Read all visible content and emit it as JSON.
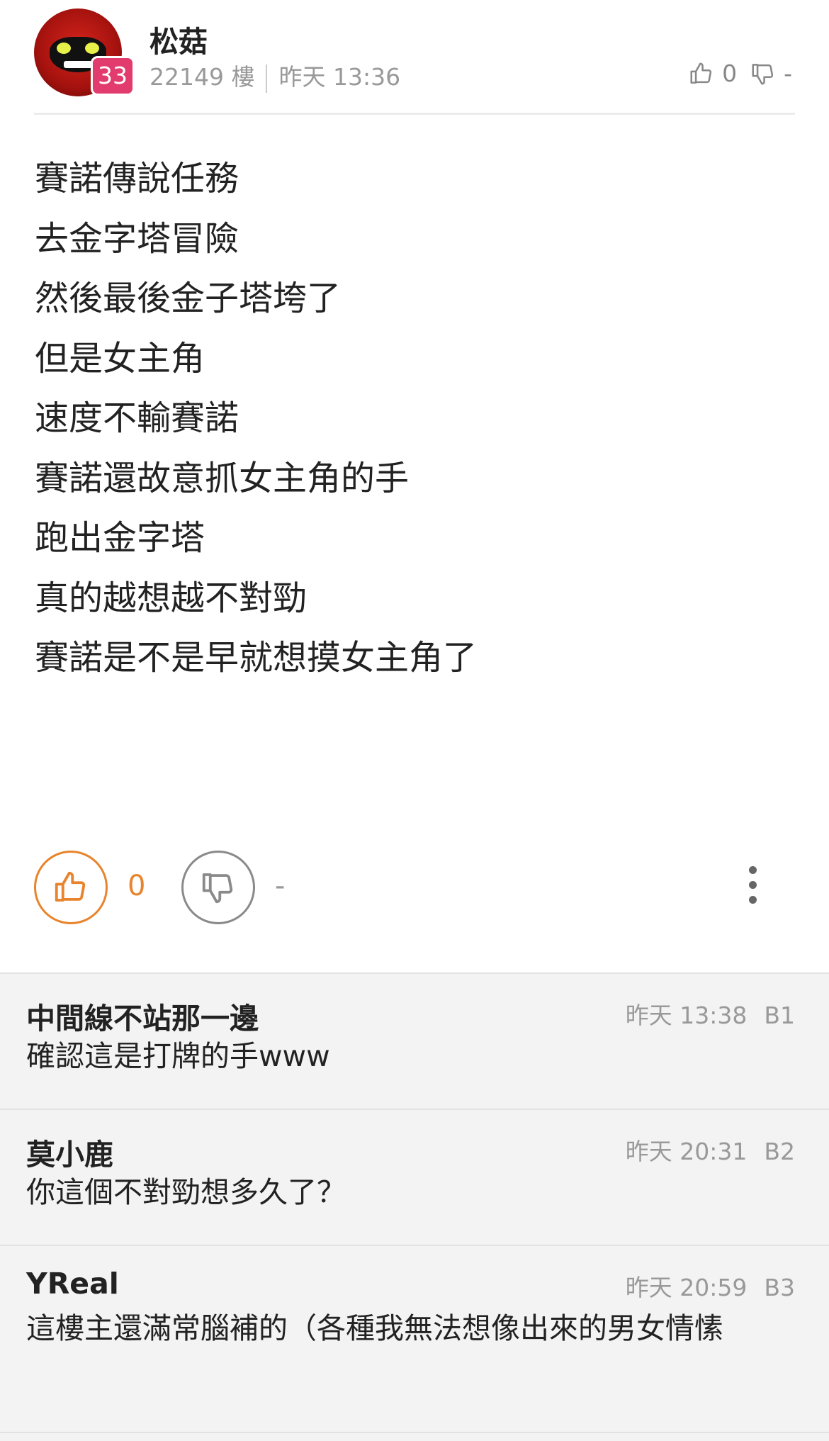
{
  "post": {
    "author": "松菇",
    "level": "33",
    "floor": "22149 樓",
    "time": "昨天 13:36",
    "mini_like_count": "0",
    "mini_dislike_count": "-",
    "lines": [
      "賽諾傳說任務",
      "去金字塔冒險",
      "然後最後金子塔垮了",
      "但是女主角",
      "速度不輸賽諾",
      "賽諾還故意抓女主角的手",
      "跑出金字塔",
      "真的越想越不對勁",
      "賽諾是不是早就想摸女主角了"
    ],
    "like_count": "0",
    "dislike_count": "-"
  },
  "replies": [
    {
      "name": "中間線不站那一邊",
      "time": "昨天 13:38",
      "floor": "B1",
      "text": "確認這是打牌的手www"
    },
    {
      "name": "莫小鹿",
      "time": "昨天 20:31",
      "floor": "B2",
      "text": "你這個不對勁想多久了？"
    },
    {
      "name": "YReal",
      "time": "昨天 20:59",
      "floor": "B3",
      "text": "這樓主還滿常腦補的（各種我無法想像出來的男女情愫"
    }
  ],
  "colors": {
    "accent": "#e8842d",
    "level_badge": "#e23b6d",
    "muted_text": "#999999",
    "reply_bg": "#f3f3f3"
  },
  "icons": [
    "thumbs-up-icon",
    "thumbs-down-icon",
    "more-vertical-icon"
  ]
}
